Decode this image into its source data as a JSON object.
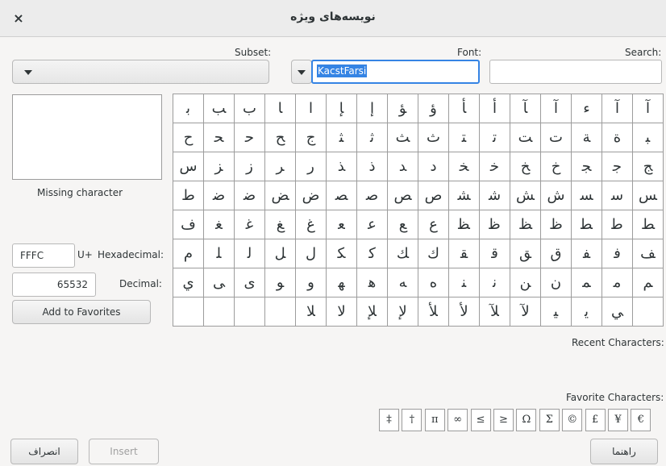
{
  "window": {
    "title": "نویسه‌های ویژه",
    "close_icon": "×"
  },
  "labels": {
    "subset": "Subset:",
    "font": "Font:",
    "search": "Search:",
    "missing": "Missing character",
    "hex_suffix": "U+",
    "hex": "Hexadecimal:",
    "decimal": "Decimal:",
    "recent": "Recent Characters:",
    "favorite": "Favorite Characters:"
  },
  "font_field": {
    "value": "KacstFarsi"
  },
  "search_field": {
    "value": ""
  },
  "hex_field": {
    "value": "FFFC"
  },
  "decimal_field": {
    "value": "65532"
  },
  "buttons": {
    "add_favorites": "Add to Favorites",
    "cancel": "انصراف",
    "insert": "Insert",
    "help": "راهنما"
  },
  "grid": {
    "rows": [
      [
        "ﺑ",
        "ﺐ",
        "ب",
        "ﺎ",
        "ا",
        "ﺈ",
        "ﺇ",
        "ﺆ",
        "ﺅ",
        "ﺄ",
        "ﺃ",
        "ﺂ",
        "ﺁ",
        "ﺀ",
        "ﺁ",
        "آ"
      ],
      [
        "ح",
        "ﺤ",
        "ﺣ",
        "ﺢ",
        "ج",
        "ﺜ",
        "ﺛ",
        "ﺚ",
        "ث",
        "ﺘ",
        "ﺗ",
        "ﺖ",
        "ت",
        "ﺔ",
        "ة",
        "ﺒ"
      ],
      [
        "س",
        "ﺰ",
        "ز",
        "ﺮ",
        "ر",
        "ﺬ",
        "ذ",
        "ﺪ",
        "د",
        "ﺨ",
        "ﺧ",
        "ﺦ",
        "خ",
        "ﺠ",
        "ﺟ",
        "ﺞ"
      ],
      [
        "ط",
        "ﺿ",
        "ﺿ",
        "ﺾ",
        "ض",
        "ﺼ",
        "ﺻ",
        "ﺺ",
        "ص",
        "ﺸ",
        "ﺷ",
        "ﺶ",
        "ش",
        "ﺴ",
        "ﺳ",
        "ﺲ"
      ],
      [
        "ف",
        "ﻐ",
        "ﻏ",
        "ﻎ",
        "غ",
        "ﻌ",
        "ﻋ",
        "ﻊ",
        "ع",
        "ﻈ",
        "ﻇ",
        "ﻆ",
        "ظ",
        "ﻄ",
        "ﻃ",
        "ﻂ"
      ],
      [
        "م",
        "ﻠ",
        "ﻟ",
        "ﻞ",
        "ل",
        "ﻜ",
        "ﻛ",
        "ﻚ",
        "ك",
        "ﻘ",
        "ﻗ",
        "ﻖ",
        "ق",
        "ﻔ",
        "ﻓ",
        "ﻒ"
      ],
      [
        "ي",
        "ﻰ",
        "ى",
        "ﻮ",
        "و",
        "ﻬ",
        "ﻫ",
        "ﻪ",
        "ه",
        "ﻨ",
        "ﻧ",
        "ﻦ",
        "ن",
        "ﻤ",
        "ﻣ",
        "ﻢ"
      ],
      [
        "",
        "",
        "",
        "",
        "ﻼ",
        "ﻻ",
        "ﻺ",
        "ﻹ",
        "ﻸ",
        "ﻷ",
        "ﻶ",
        "ﻵ",
        "ﻴ",
        "ﻳ",
        "ﻲ",
        ""
      ]
    ]
  },
  "favorites": [
    "‡",
    "†",
    "π",
    "∞",
    "≤",
    "≥",
    "Ω",
    "Σ",
    "©",
    "£",
    "¥",
    "€"
  ]
}
